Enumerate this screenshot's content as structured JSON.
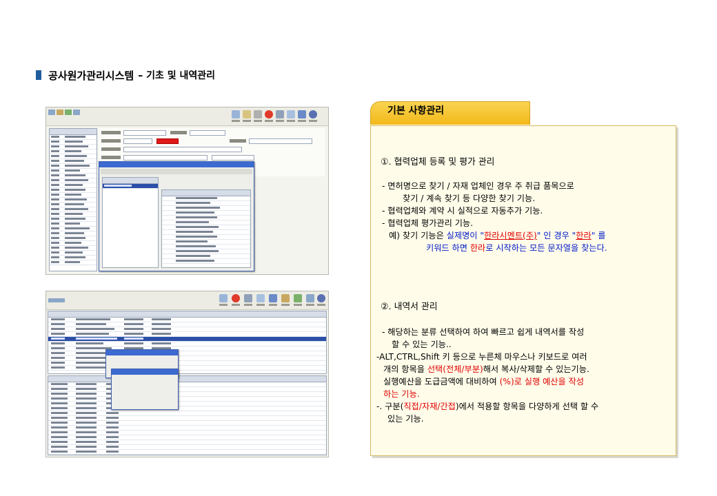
{
  "title": {
    "main": "공사원가관리시스템",
    "sub": "– 기초 및 내역관리"
  },
  "panel": {
    "tab": "기본 사항관리",
    "s1": "①. 협력업체 등록 및 평가 관리",
    "l1": "-  면허명으로 찾기 / 자재 업체인 경우 주 취급 품목으로",
    "l2": "찾기 / 계속 찾기 등 다양한 찾기 기능.",
    "l3": "- 협력업체와 계약 시 실적으로 자동추가 기능.",
    "l4": "- 협력업체 평가관리 기능.",
    "l5a": "예) 찾기 기능은 ",
    "l5b": "실제명이 \"",
    "l5c": "한라시멘트(주)",
    "l5d": "\" 인 경우 \"",
    "l5e": "한라",
    "l5f": "\"  를",
    "l6a": "키워드 하면 ",
    "l6b": "한라",
    "l6c": "로 시작하는 모든 문자열을 찾는다.",
    "s2": "②. 내역서 관리",
    "m1": "- 해당하는 분류 선택하여  하여 빠르고 쉽게 내역서를 작성",
    "m2": "할 수 있는 기능..",
    "m3": "-ALT,CTRL,Shift  키 등으로 누른체 마우스나 키보드로 여러",
    "m4a": "개의 항목을 ",
    "m4b": "선택(전체/부분)",
    "m4c": "해서 복사/삭제할 수 있는기능.",
    "m5a": "실행예산을 도급금액에 대비하여 ",
    "m5b": "(%)로 실행 예산을 작성",
    "m6": "하는 기능.",
    "m7a": "-. 구분(",
    "m7b": "직접/자재/간접",
    "m7c": ")에서 적용할 항목을 다양하게 선택 할 수",
    "m8": "있는 기능."
  },
  "colors": {
    "accent": "#1f5e9e",
    "tab": "#f3c22a",
    "note_bg": "#fffdea",
    "red": "#e00000",
    "blue": "#0018c8"
  },
  "screens": [
    {
      "name": "partner-management-window",
      "icons": [
        "cut-icon",
        "copy-icon",
        "paste-icon",
        "delete-icon",
        "print-icon",
        "search-icon",
        "save-icon",
        "exit-icon"
      ]
    },
    {
      "name": "bill-of-quantities-window",
      "icons": [
        "cut-icon",
        "delete-icon",
        "print-icon",
        "search-icon",
        "save-icon",
        "exit-icon"
      ]
    }
  ]
}
